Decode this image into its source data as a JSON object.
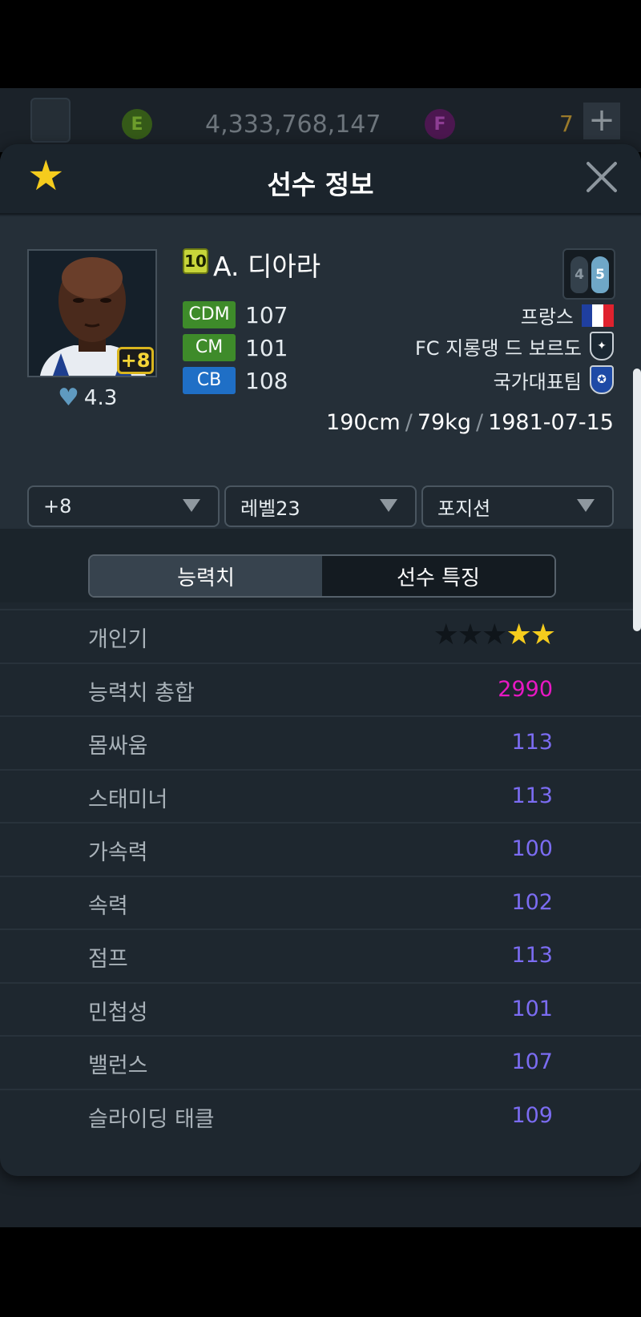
{
  "topbar": {
    "coin_e_label": "E",
    "coin_e_amount": "4,333,768,147",
    "coin_f_label": "F",
    "coin_f_amount": "7",
    "plus_label": "+"
  },
  "modal": {
    "title": "선수 정보",
    "favorite_icon": "star-icon",
    "close_icon": "close-icon"
  },
  "player": {
    "season_badge": "10",
    "name": "A. 디아라",
    "enhance_level": "+8",
    "rating": "4.3",
    "foot_left": "4",
    "foot_right": "5",
    "positions": [
      {
        "pos": "CDM",
        "value": "107",
        "color": "#3e8b2a"
      },
      {
        "pos": "CM",
        "value": "101",
        "color": "#3e8b2a"
      },
      {
        "pos": "CB",
        "value": "108",
        "color": "#1f6fc6"
      }
    ],
    "nation": "프랑스",
    "club": "FC 지롱댕 드 보르도",
    "national_team": "국가대표팀",
    "height": "190cm",
    "weight": "79kg",
    "birthdate": "1981-07-15",
    "separator": "/"
  },
  "selectors": {
    "enhance": "+8",
    "level": "레벨23",
    "position": "포지션"
  },
  "tabs": {
    "stats": "능력치",
    "traits": "선수 특징"
  },
  "stats": {
    "popularity_label": "개인기",
    "popularity_stars": 2,
    "popularity_max": 5,
    "rows": [
      {
        "label": "능력치 총합",
        "value": "2990"
      },
      {
        "label": "몸싸움",
        "value": "113"
      },
      {
        "label": "스태미너",
        "value": "113"
      },
      {
        "label": "가속력",
        "value": "100"
      },
      {
        "label": "속력",
        "value": "102"
      },
      {
        "label": "점프",
        "value": "113"
      },
      {
        "label": "민첩성",
        "value": "101"
      },
      {
        "label": "밸런스",
        "value": "107"
      },
      {
        "label": "슬라이딩 태클",
        "value": "109"
      }
    ]
  },
  "colors": {
    "accent_star": "#f5cc1d",
    "total_value": "#e818c4",
    "stat_value": "#7b6cf2"
  }
}
